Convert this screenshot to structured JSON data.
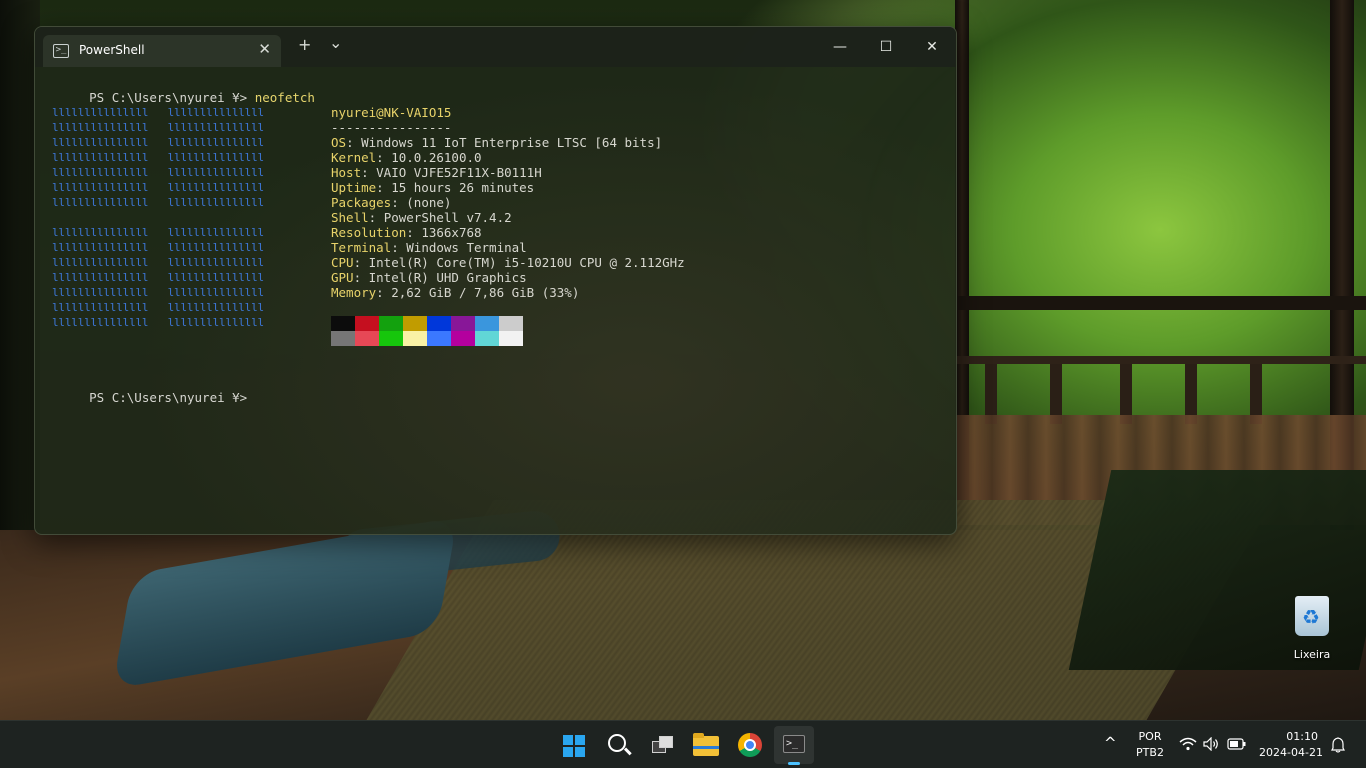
{
  "window": {
    "tab_title": "PowerShell",
    "new_tab": "+",
    "dropdown": "⌄",
    "tab_close": "✕",
    "minimize": "—",
    "maximize": "☐",
    "close": "✕"
  },
  "terminal": {
    "prompt1": "PS C:\\Users\\nyurei ¥> ",
    "command1": "neofetch",
    "prompt2": "PS C:\\Users\\nyurei ¥>",
    "logo_block_top": "lllllllllllllll   lllllllllllllll\nlllllllllllllll   lllllllllllllll\nlllllllllllllll   lllllllllllllll\nlllllllllllllll   lllllllllllllll\nlllllllllllllll   lllllllllllllll\nlllllllllllllll   lllllllllllllll\nlllllllllllllll   lllllllllllllll",
    "logo_block_bottom": "lllllllllllllll   lllllllllllllll\nlllllllllllllll   lllllllllllllll\nlllllllllllllll   lllllllllllllll\nlllllllllllllll   lllllllllllllll\nlllllllllllllll   lllllllllllllll\nlllllllllllllll   lllllllllllllll\nlllllllllllllll   lllllllllllllll",
    "user_host": "nyurei@NK-VAIO15",
    "separator": "----------------",
    "info": [
      {
        "key": "OS",
        "value": ": Windows 11 IoT Enterprise LTSC [64 bits]"
      },
      {
        "key": "Kernel",
        "value": ": 10.0.26100.0"
      },
      {
        "key": "Host",
        "value": ": VAIO VJFE52F11X-B0111H"
      },
      {
        "key": "Uptime",
        "value": ": 15 hours 26 minutes"
      },
      {
        "key": "Packages",
        "value": ": (none)"
      },
      {
        "key": "Shell",
        "value": ": PowerShell v7.4.2"
      },
      {
        "key": "Resolution",
        "value": ": 1366x768"
      },
      {
        "key": "Terminal",
        "value": ": Windows Terminal"
      },
      {
        "key": "CPU",
        "value": ": Intel(R) Core(TM) i5-10210U CPU @ 2.112GHz"
      },
      {
        "key": "GPU",
        "value": ": Intel(R) UHD Graphics"
      },
      {
        "key": "Memory",
        "value": ": 2,62 GiB / 7,86 GiB (33%)"
      }
    ],
    "palette_top": [
      "#0c0c0c",
      "#c50f1f",
      "#13a10e",
      "#c19c00",
      "#0037da",
      "#881798",
      "#3a96dd",
      "#cccccc"
    ],
    "palette_bottom": [
      "#767676",
      "#e74856",
      "#16c60c",
      "#f9f1a5",
      "#3b78ff",
      "#b4009e",
      "#61d6d6",
      "#f2f2f2"
    ]
  },
  "desktop": {
    "recycle_bin_label": "Lixeira"
  },
  "taskbar": {
    "apps": [
      "start-icon",
      "search-icon",
      "task-view-icon",
      "file-explorer-icon",
      "chrome-icon",
      "terminal-icon"
    ],
    "tray_chevron": "^",
    "lang_top": "POR",
    "lang_bottom": "PTB2",
    "wifi_icon": "wifi-icon",
    "volume_icon": "volume-icon",
    "battery_icon": "battery-icon",
    "time": "01:10",
    "date": "2024-04-21",
    "accent": "#4cc2ff"
  }
}
